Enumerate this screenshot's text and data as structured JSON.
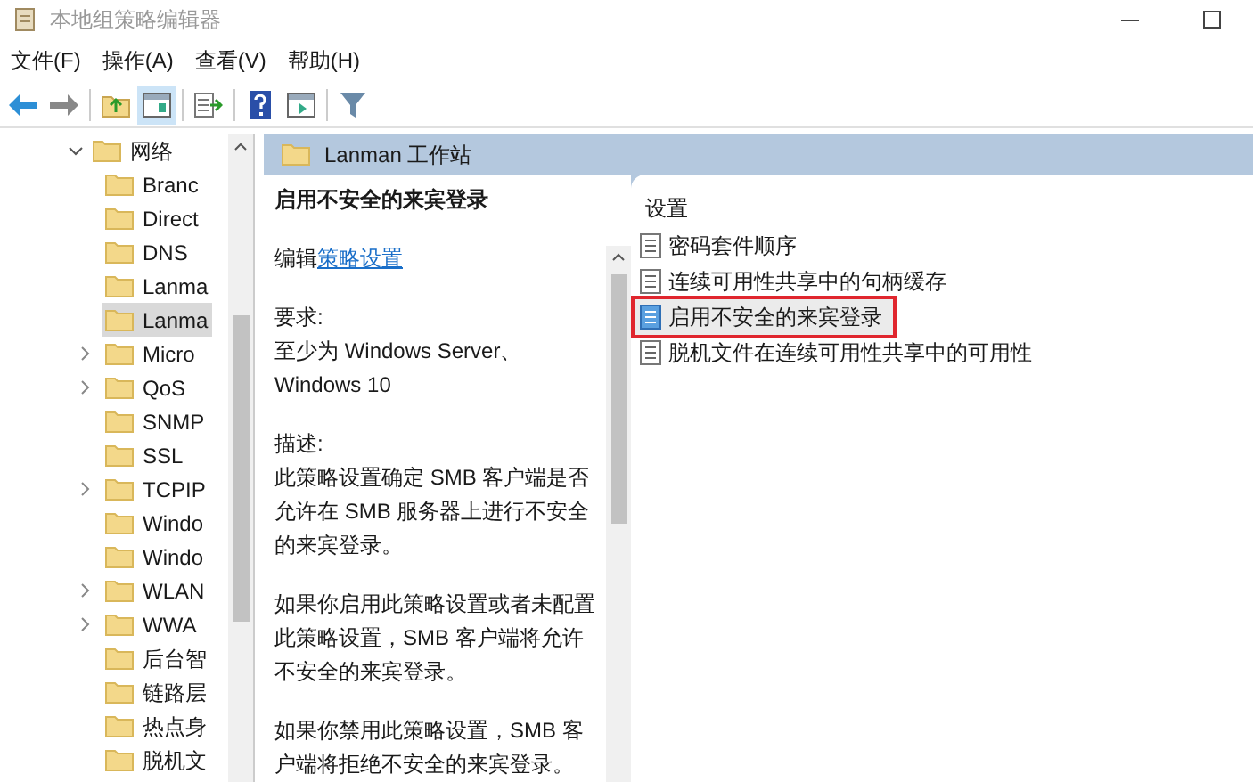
{
  "window": {
    "title": "本地组策略编辑器"
  },
  "menu": [
    {
      "label": "文件(F)"
    },
    {
      "label": "操作(A)"
    },
    {
      "label": "查看(V)"
    },
    {
      "label": "帮助(H)"
    }
  ],
  "tree": {
    "label": "网络",
    "expanded": true,
    "children": [
      {
        "label": "Branc",
        "expandable": false,
        "selected": false
      },
      {
        "label": "Direct",
        "expandable": false,
        "selected": false
      },
      {
        "label": "DNS",
        "expandable": false,
        "selected": false
      },
      {
        "label": "Lanma",
        "expandable": false,
        "selected": false
      },
      {
        "label": "Lanma",
        "expandable": false,
        "selected": true
      },
      {
        "label": "Micro",
        "expandable": true,
        "selected": false
      },
      {
        "label": "QoS",
        "expandable": true,
        "selected": false
      },
      {
        "label": "SNMP",
        "expandable": false,
        "selected": false
      },
      {
        "label": "SSL",
        "expandable": false,
        "selected": false
      },
      {
        "label": "TCPIP",
        "expandable": true,
        "selected": false
      },
      {
        "label": "Windo",
        "expandable": false,
        "selected": false
      },
      {
        "label": "Windo",
        "expandable": false,
        "selected": false
      },
      {
        "label": "WLAN",
        "expandable": true,
        "selected": false
      },
      {
        "label": "WWA",
        "expandable": true,
        "selected": false
      },
      {
        "label": "后台智",
        "expandable": false,
        "selected": false
      },
      {
        "label": "链路层",
        "expandable": false,
        "selected": false
      },
      {
        "label": "热点身",
        "expandable": false,
        "selected": false
      },
      {
        "label": "脱机文",
        "expandable": false,
        "selected": false
      }
    ]
  },
  "detail": {
    "header": "Lanman 工作站",
    "title": "启用不安全的来宾登录",
    "edit_prefix": "编辑",
    "edit_link": "策略设置",
    "requirements_label": "要求:",
    "requirements": "至少为 Windows Server、Windows 10",
    "description_label": "描述:",
    "paragraphs": [
      "此策略设置确定 SMB 客户端是否允许在 SMB 服务器上进行不安全的来宾登录。",
      "如果你启用此策略设置或者未配置此策略设置，SMB 客户端将允许不安全的来宾登录。",
      "如果你禁用此策略设置，SMB 客户端将拒绝不安全的来宾登录。"
    ]
  },
  "settings": {
    "column": "设置",
    "items": [
      {
        "label": "密码套件顺序",
        "selected": false
      },
      {
        "label": "连续可用性共享中的句柄缓存",
        "selected": false
      },
      {
        "label": "启用不安全的来宾登录",
        "selected": true
      },
      {
        "label": "脱机文件在连续可用性共享中的可用性",
        "selected": false
      }
    ]
  }
}
